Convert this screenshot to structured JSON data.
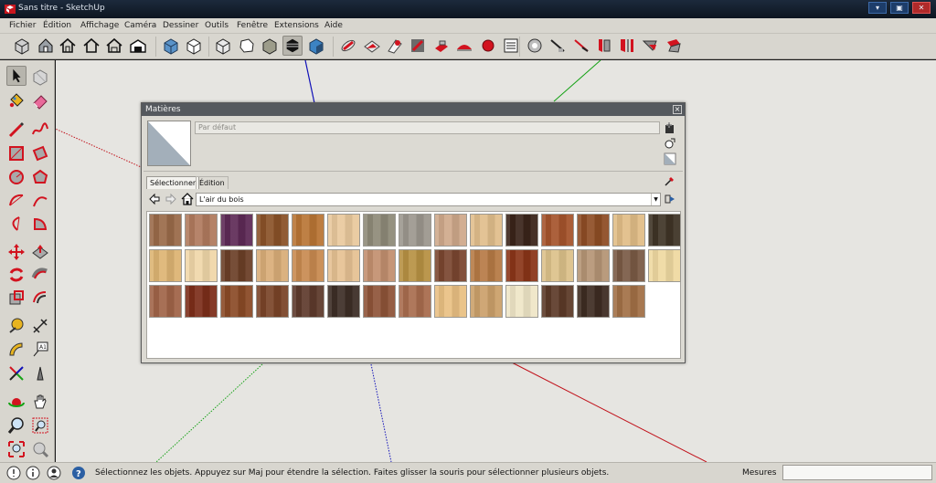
{
  "window": {
    "title": "Sans titre - SketchUp"
  },
  "menu": [
    "Fichier",
    "Édition",
    "Affichage",
    "Caméra",
    "Dessiner",
    "Outils",
    "Fenêtre",
    "Extensions",
    "Aide"
  ],
  "toolbar_icons": [
    "component-icon",
    "house-icon",
    "house-outline-icon",
    "house-front-icon",
    "warehouse-icon",
    "iso-view-icon",
    "top-view-icon",
    "front-view-icon",
    "right-view-icon",
    "back-view-icon",
    "left-view-icon",
    "xray-style-icon",
    "wireframe-style-icon",
    "hidden-line-style-icon",
    "shaded-style-icon",
    "textured-style-icon",
    "monochrome-style-icon",
    "section-plane-icon",
    "sandbox-from-contours-icon",
    "sandbox-from-scratch-icon",
    "smoove-icon",
    "stamp-icon",
    "drape-icon",
    "add-detail-icon",
    "flip-edge-icon",
    "solid-outer-shell-icon",
    "solid-intersect-icon",
    "solid-union-icon",
    "solid-subtract-icon",
    "solid-trim-icon",
    "solid-split-icon",
    "paint-bucket-3d-icon",
    "push-pull-style-icon"
  ],
  "left_toolbar_icons": [
    "select-icon",
    "make-component-icon",
    "paint-bucket-icon",
    "eraser-icon",
    "pencil-icon",
    "freehand-icon",
    "rectangle-icon",
    "rotated-rectangle-icon",
    "circle-icon",
    "polygon-icon",
    "arc-icon",
    "two-point-arc-icon",
    "three-point-arc-icon",
    "pie-icon",
    "move-icon",
    "push-pull-icon",
    "rotate-icon",
    "follow-me-icon",
    "scale-icon",
    "offset-icon",
    "tape-measure-icon",
    "dimension-icon",
    "protractor-icon",
    "text-icon",
    "axes-icon",
    "3d-text-icon",
    "orbit-icon",
    "pan-icon",
    "zoom-icon",
    "zoom-window-icon",
    "zoom-extents-icon",
    "position-camera-icon"
  ],
  "dialog": {
    "title": "Matières",
    "close": "×",
    "material_name": "Par défaut",
    "tabs": {
      "select": "Sélectionner",
      "edit": "Édition"
    },
    "collection": "L'air du bois"
  },
  "swatches": [
    [
      "#9a6a49",
      "#b07a5e",
      "#5e2a56",
      "#8a5228",
      "#b97535",
      "#e9c99d",
      "#8e8a78",
      "#9c978e",
      "#cfa98b",
      "#e1be8c",
      "#3a241a",
      "#a5542c",
      "#8e4d25",
      "#e1bd87",
      "#3f3426"
    ],
    [
      "#ddb473",
      "#f0d7a9",
      "#6b3f27",
      "#d9ad78",
      "#c88a50",
      "#e6c193",
      "#c28f6f",
      "#b79143",
      "#7a4630",
      "#b67a45",
      "#8a3518",
      "#dcc18a",
      "#b59575",
      "#7a5a45",
      "#efd9a1"
    ],
    [
      "#a06448",
      "#7c2e1a",
      "#8a4a26",
      "#7a4428",
      "#5e3a2c",
      "#3d2e26",
      "#8e5438",
      "#a86c4e",
      "#e9c083",
      "#cba06a",
      "#efe6c7",
      "#5c3a28",
      "#3e2c22",
      "#a27046"
    ]
  ],
  "status": {
    "hint": "Sélectionnez les objets. Appuyez sur Maj pour étendre la sélection. Faites glisser la souris pour sélectionner plusieurs objets.",
    "measure_label": "Mesures",
    "measure_value": ""
  },
  "colors": {
    "red_axis": "#c1121b",
    "green_axis": "#15a215",
    "blue_axis": "#1010b8",
    "icon_red": "#d2131f",
    "canvas": "#e6e5e1"
  }
}
